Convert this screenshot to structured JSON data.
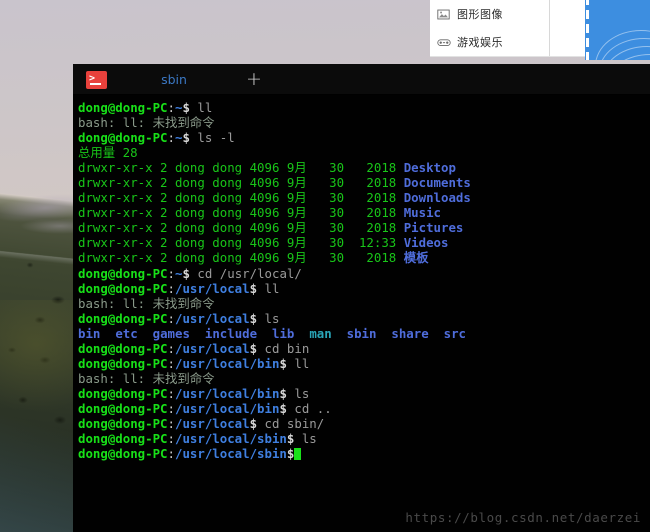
{
  "desktop": {
    "wallpaper_description": "mountain-hillside-photo",
    "sky_color": "#d2c8c4",
    "hill_color": "#3e4630"
  },
  "popup_menu": {
    "items": [
      {
        "icon": "image-icon",
        "label": "图形图像"
      },
      {
        "icon": "gamepad-icon",
        "label": "游戏娱乐"
      }
    ]
  },
  "blue_panel": {
    "color": "#3d8ee0",
    "accent": "dashed-line-and-arcs"
  },
  "terminal": {
    "tabbar": {
      "app_icon": "terminal-icon",
      "tabs": [
        {
          "label": "sbin",
          "active": true
        }
      ],
      "new_tab_label": "+"
    },
    "colors": {
      "background": "#010101",
      "prompt_user": "#18e018",
      "prompt_path": "#3f7fe0",
      "output": "#19c519",
      "directory": "#4f6ddb",
      "symlink": "#2aa6b8",
      "error": "#8a9a8a",
      "cursor": "#19e019"
    },
    "prompt_user_host": "dong@dong-PC",
    "lines": [
      {
        "type": "prompt",
        "path": "~",
        "command": " ll"
      },
      {
        "type": "error",
        "text": "bash: ll: 未找到命令"
      },
      {
        "type": "prompt",
        "path": "~",
        "command": " ls -l"
      },
      {
        "type": "output",
        "text": "总用量 28"
      },
      {
        "type": "listing",
        "perms": "drwxr-xr-x",
        "links": "2",
        "owner": "dong",
        "group": "dong",
        "size": "4096",
        "month": "9月",
        "day": "30",
        "time": "2018",
        "name": "Desktop"
      },
      {
        "type": "listing",
        "perms": "drwxr-xr-x",
        "links": "2",
        "owner": "dong",
        "group": "dong",
        "size": "4096",
        "month": "9月",
        "day": "30",
        "time": "2018",
        "name": "Documents"
      },
      {
        "type": "listing",
        "perms": "drwxr-xr-x",
        "links": "2",
        "owner": "dong",
        "group": "dong",
        "size": "4096",
        "month": "9月",
        "day": "30",
        "time": "2018",
        "name": "Downloads"
      },
      {
        "type": "listing",
        "perms": "drwxr-xr-x",
        "links": "2",
        "owner": "dong",
        "group": "dong",
        "size": "4096",
        "month": "9月",
        "day": "30",
        "time": "2018",
        "name": "Music"
      },
      {
        "type": "listing",
        "perms": "drwxr-xr-x",
        "links": "2",
        "owner": "dong",
        "group": "dong",
        "size": "4096",
        "month": "9月",
        "day": "30",
        "time": "2018",
        "name": "Pictures"
      },
      {
        "type": "listing",
        "perms": "drwxr-xr-x",
        "links": "2",
        "owner": "dong",
        "group": "dong",
        "size": "4096",
        "month": "9月",
        "day": "30",
        "time": "12:33",
        "name": "Videos"
      },
      {
        "type": "listing",
        "perms": "drwxr-xr-x",
        "links": "2",
        "owner": "dong",
        "group": "dong",
        "size": "4096",
        "month": "9月",
        "day": "30",
        "time": "2018",
        "name": "模板"
      },
      {
        "type": "prompt",
        "path": "~",
        "command": " cd /usr/local/"
      },
      {
        "type": "prompt",
        "path": "/usr/local",
        "command": " ll"
      },
      {
        "type": "error",
        "text": "bash: ll: 未找到命令"
      },
      {
        "type": "prompt",
        "path": "/usr/local",
        "command": " ls"
      },
      {
        "type": "ls_dirs",
        "entries": [
          {
            "name": "bin",
            "kind": "dir"
          },
          {
            "name": "etc",
            "kind": "dir"
          },
          {
            "name": "games",
            "kind": "dir"
          },
          {
            "name": "include",
            "kind": "dir"
          },
          {
            "name": "lib",
            "kind": "dir"
          },
          {
            "name": "man",
            "kind": "link"
          },
          {
            "name": "sbin",
            "kind": "dir"
          },
          {
            "name": "share",
            "kind": "dir"
          },
          {
            "name": "src",
            "kind": "dir"
          }
        ]
      },
      {
        "type": "prompt",
        "path": "/usr/local",
        "command": " cd bin"
      },
      {
        "type": "prompt",
        "path": "/usr/local/bin",
        "command": " ll"
      },
      {
        "type": "error",
        "text": "bash: ll: 未找到命令"
      },
      {
        "type": "prompt",
        "path": "/usr/local/bin",
        "command": " ls"
      },
      {
        "type": "prompt",
        "path": "/usr/local/bin",
        "command": " cd .."
      },
      {
        "type": "prompt",
        "path": "/usr/local",
        "command": " cd sbin/"
      },
      {
        "type": "prompt",
        "path": "/usr/local/sbin",
        "command": " ls"
      },
      {
        "type": "prompt",
        "path": "/usr/local/sbin",
        "command": "",
        "cursor": true
      }
    ]
  },
  "watermark": {
    "text": "https://blog.csdn.net/daerzei"
  }
}
